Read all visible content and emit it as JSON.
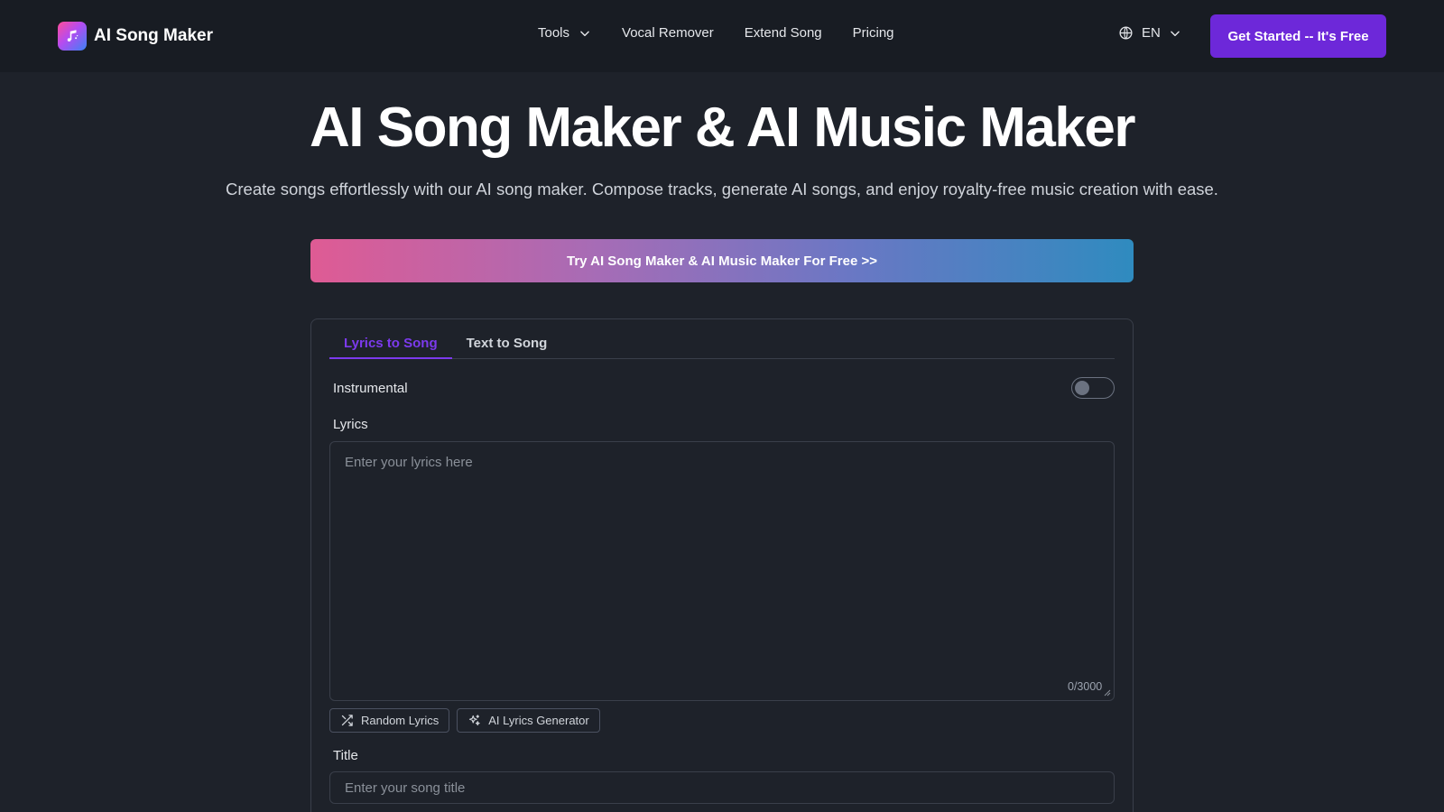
{
  "header": {
    "logo_text": "AI Song Maker",
    "nav": [
      {
        "label": "Tools"
      },
      {
        "label": "Vocal Remover"
      },
      {
        "label": "Extend Song"
      },
      {
        "label": "Pricing"
      }
    ],
    "language": "EN",
    "cta_label": "Get Started -- It's Free"
  },
  "hero": {
    "title": "AI Song Maker & AI Music Maker",
    "subtitle": "Create songs effortlessly with our AI song maker. Compose tracks, generate AI songs, and enjoy royalty-free music creation with ease.",
    "try_banner": "Try AI Song Maker & AI Music Maker For Free >>"
  },
  "form": {
    "tabs": [
      {
        "label": "Lyrics to Song",
        "active": true
      },
      {
        "label": "Text to Song",
        "active": false
      }
    ],
    "instrumental_label": "Instrumental",
    "instrumental_on": false,
    "lyrics_label": "Lyrics",
    "lyrics_placeholder": "Enter your lyrics here",
    "lyrics_value": "",
    "lyrics_counter": "0/3000",
    "random_lyrics_label": "Random Lyrics",
    "ai_lyrics_label": "AI Lyrics Generator",
    "title_label": "Title",
    "title_placeholder": "Enter your song title",
    "title_value": ""
  },
  "colors": {
    "accent": "#6d28d9",
    "tab_active": "#7c3aed",
    "background": "#1e222a",
    "header_bg": "#181c23"
  },
  "icons": {
    "logo": "music-note-icon",
    "tools_chevron": "chevron-down-icon",
    "language": "globe-icon",
    "language_chevron": "chevron-down-icon",
    "random": "shuffle-icon",
    "ai_generator": "sparkles-icon"
  }
}
